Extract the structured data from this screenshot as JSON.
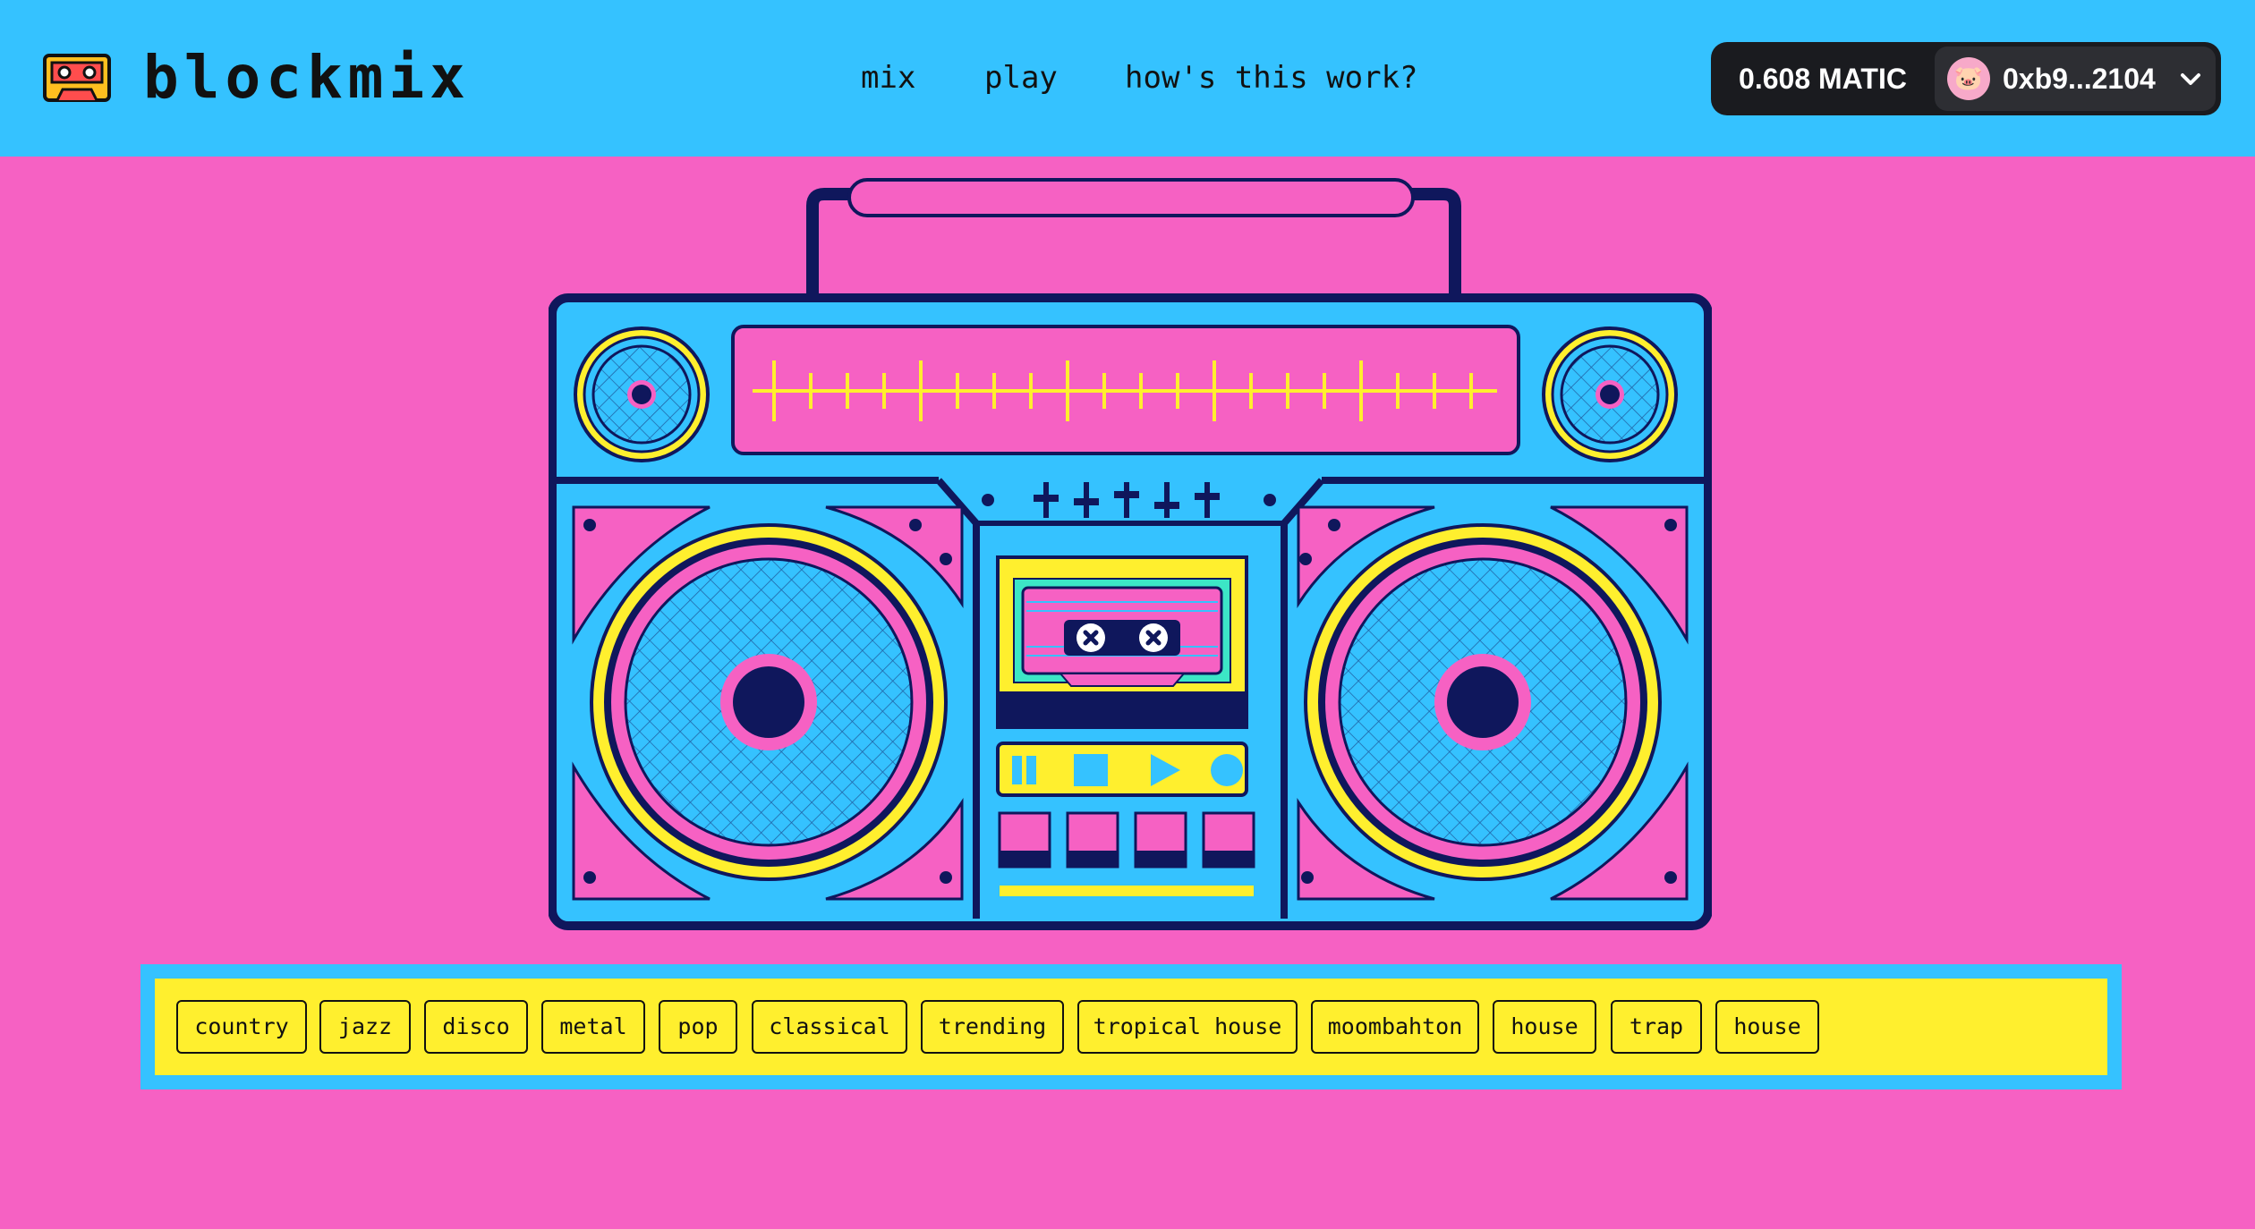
{
  "app": {
    "name": "blockmix",
    "logo_icon": "cassette-icon"
  },
  "nav": {
    "mix": "mix",
    "play": "play",
    "how": "how's this work?"
  },
  "wallet": {
    "balance": "0.608 MATIC",
    "address": "0xb9...2104",
    "avatar_emoji": "🐷",
    "dropdown_icon": "chevron-down-icon"
  },
  "hero": {
    "illustration": "boombox-icon"
  },
  "genres": [
    "country",
    "jazz",
    "disco",
    "metal",
    "pop",
    "classical",
    "trending",
    "tropical house",
    "moombahton",
    "house",
    "trap",
    "house"
  ],
  "colors": {
    "background": "#f661c3",
    "header": "#35c2ff",
    "tag_panel": "#ffef2e",
    "navy": "#0f175c",
    "yellow": "#ffef2e"
  }
}
